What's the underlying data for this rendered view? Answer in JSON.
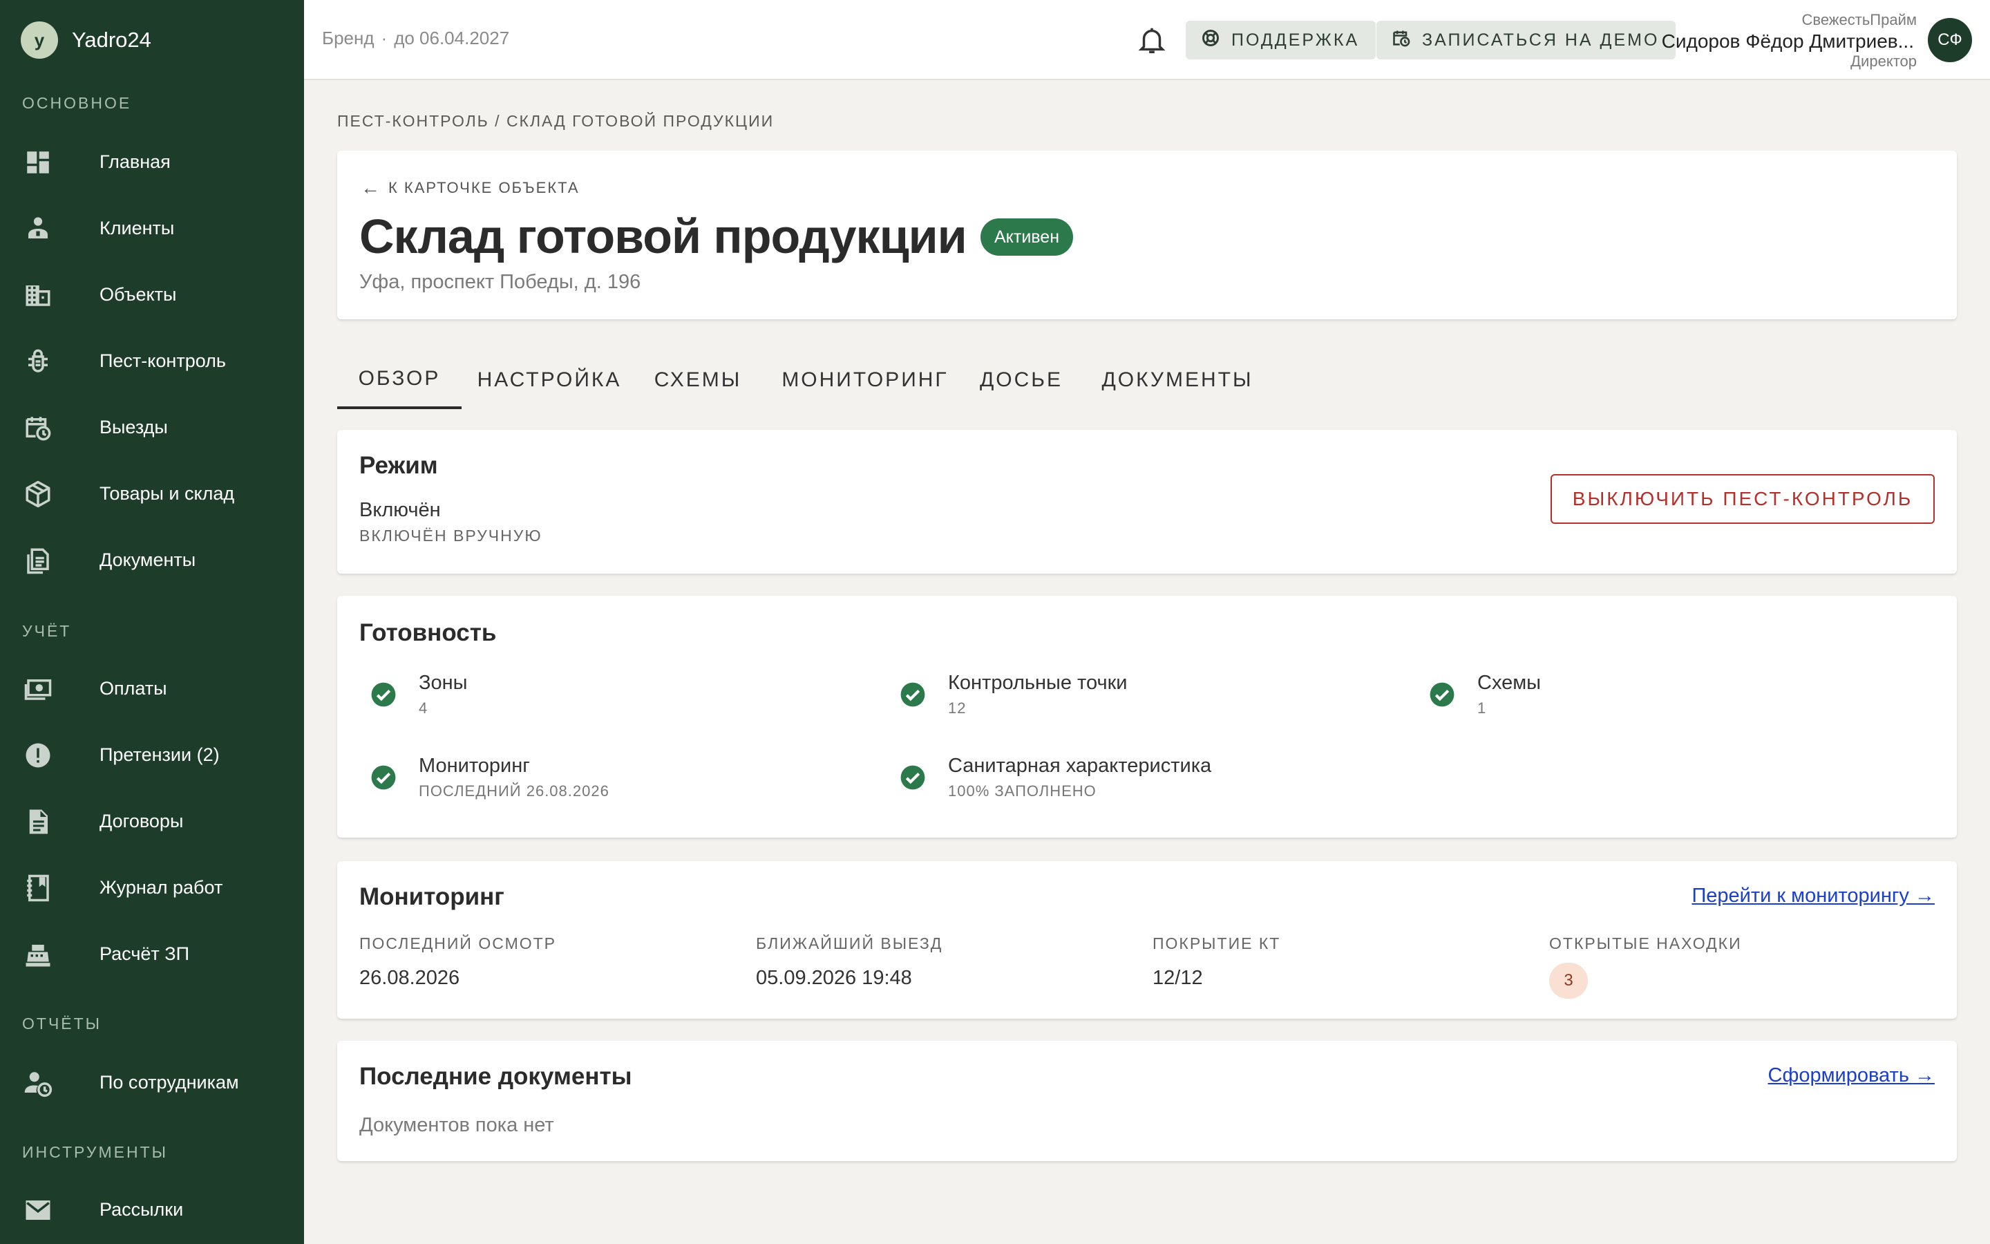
{
  "app": {
    "name": "Yadro24",
    "logo_letter": "y"
  },
  "sidebar": {
    "sections": [
      {
        "title": "ОСНОВНОЕ",
        "items": [
          {
            "label": "Главная",
            "icon": "dashboard-icon"
          },
          {
            "label": "Клиенты",
            "icon": "person-icon"
          },
          {
            "label": "Объекты",
            "icon": "building-icon"
          },
          {
            "label": "Пест-контроль",
            "icon": "bug-icon"
          },
          {
            "label": "Выезды",
            "icon": "calendar-clock-icon"
          },
          {
            "label": "Товары и склад",
            "icon": "package-icon"
          },
          {
            "label": "Документы",
            "icon": "document-icon"
          }
        ]
      },
      {
        "title": "УЧЁТ",
        "items": [
          {
            "label": "Оплаты",
            "icon": "payments-icon"
          },
          {
            "label": "Претензии (2)",
            "icon": "alert-icon"
          },
          {
            "label": "Договоры",
            "icon": "contract-icon"
          },
          {
            "label": "Журнал работ",
            "icon": "journal-icon"
          },
          {
            "label": "Расчёт ЗП",
            "icon": "cash-register-icon"
          }
        ]
      },
      {
        "title": "ОТЧЁТЫ",
        "items": [
          {
            "label": "По сотрудникам",
            "icon": "person-clock-icon"
          }
        ]
      },
      {
        "title": "ИНСТРУМЕНТЫ",
        "items": [
          {
            "label": "Рассылки",
            "icon": "mail-icon"
          }
        ]
      }
    ]
  },
  "header": {
    "brand_label": "Бренд",
    "brand_separator": "·",
    "brand_until": "до 06.04.2027",
    "support_label": "ПОДДЕРЖКА",
    "demo_label": "ЗАПИСАТЬСЯ НА ДЕМО",
    "user": {
      "company": "СвежестьПрайм",
      "name": "Сидоров Фёдор Дмитриев...",
      "role": "Директор",
      "initials": "СФ"
    }
  },
  "breadcrumb": "ПЕСТ-КОНТРОЛЬ / СКЛАД ГОТОВОЙ ПРОДУКЦИИ",
  "object": {
    "back_label": "К КАРТОЧКЕ ОБЪЕКТА",
    "title": "Склад готовой продукции",
    "status": "Активен",
    "address": "Уфа, проспект Победы, д. 196"
  },
  "tabs": [
    "ОБЗОР",
    "НАСТРОЙКА",
    "СХЕМЫ",
    "МОНИТОРИНГ",
    "ДОСЬЕ",
    "ДОКУМЕНТЫ"
  ],
  "mode": {
    "title": "Режим",
    "value": "Включён",
    "sub": "ВКЛЮЧЁН ВРУЧНУЮ",
    "button": "ВЫКЛЮЧИТЬ ПЕСТ-КОНТРОЛЬ"
  },
  "readiness": {
    "title": "Готовность",
    "items": [
      {
        "label": "Зоны",
        "value": "4"
      },
      {
        "label": "Контрольные точки",
        "value": "12"
      },
      {
        "label": "Схемы",
        "value": "1"
      },
      {
        "label": "Мониторинг",
        "value": "ПОСЛЕДНИЙ 26.08.2026"
      },
      {
        "label": "Санитарная характеристика",
        "value": "100% ЗАПОЛНЕНО"
      }
    ]
  },
  "monitoring": {
    "title": "Мониторинг",
    "link": "Перейти к мониторингу →",
    "last_inspection_label": "ПОСЛЕДНИЙ ОСМОТР",
    "last_inspection": "26.08.2026",
    "next_visit_label": "БЛИЖАЙШИЙ ВЫЕЗД",
    "next_visit": "05.09.2026 19:48",
    "coverage_label": "ПОКРЫТИЕ КТ",
    "coverage": "12/12",
    "findings_label": "ОТКРЫТЫЕ НАХОДКИ",
    "findings": "3"
  },
  "documents": {
    "title": "Последние документы",
    "link": "Сформировать →",
    "empty": "Документов пока нет"
  },
  "colors": {
    "sidebar_bg": "#1d3d2a",
    "accent_green": "#2c7a4b",
    "danger": "#b5302a",
    "link": "#1a3fcc",
    "page_bg": "#f4f2ee"
  }
}
